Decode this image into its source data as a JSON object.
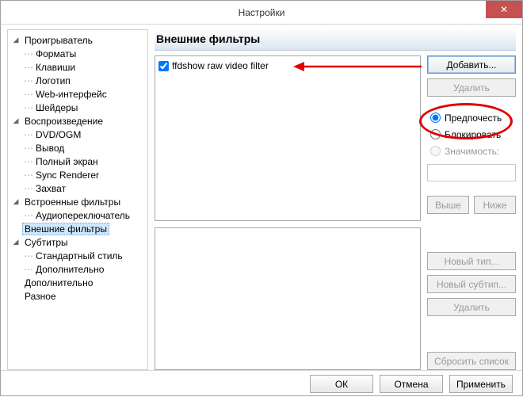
{
  "window": {
    "title": "Настройки",
    "close": "✕"
  },
  "tree": [
    {
      "label": "Проигрыватель",
      "level": 0,
      "expandable": true
    },
    {
      "label": "Форматы",
      "level": 1
    },
    {
      "label": "Клавиши",
      "level": 1
    },
    {
      "label": "Логотип",
      "level": 1
    },
    {
      "label": "Web-интерфейс",
      "level": 1
    },
    {
      "label": "Шейдеры",
      "level": 1
    },
    {
      "label": "Воспроизведение",
      "level": 0,
      "expandable": true
    },
    {
      "label": "DVD/OGM",
      "level": 1
    },
    {
      "label": "Вывод",
      "level": 1
    },
    {
      "label": "Полный экран",
      "level": 1
    },
    {
      "label": "Sync Renderer",
      "level": 1
    },
    {
      "label": "Захват",
      "level": 1
    },
    {
      "label": "Встроенные фильтры",
      "level": 0,
      "expandable": true
    },
    {
      "label": "Аудиопереключатель",
      "level": 1
    },
    {
      "label": "Внешние фильтры",
      "level": 0,
      "selected": true
    },
    {
      "label": "Субтитры",
      "level": 0,
      "expandable": true
    },
    {
      "label": "Стандартный стиль",
      "level": 1
    },
    {
      "label": "Дополнительно",
      "level": 1
    },
    {
      "label": "Дополнительно",
      "level": 0
    },
    {
      "label": "Разное",
      "level": 0
    }
  ],
  "section": {
    "title": "Внешние фильтры"
  },
  "filters": {
    "items": [
      {
        "label": "ffdshow raw video filter",
        "checked": true
      }
    ]
  },
  "buttons": {
    "add": "Добавить...",
    "remove": "Удалить",
    "up": "Выше",
    "down": "Ниже",
    "newType": "Новый тип...",
    "newSubtype": "Новый субтип...",
    "delete": "Удалить",
    "resetList": "Сбросить список"
  },
  "radios": {
    "prefer": "Предпочесть",
    "block": "Блокировать",
    "merit": "Значимость:"
  },
  "meritValue": "",
  "footer": {
    "ok": "ОК",
    "cancel": "Отмена",
    "apply": "Применить"
  }
}
